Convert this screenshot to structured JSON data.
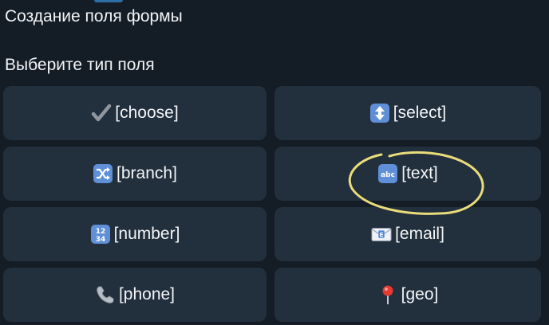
{
  "header": {
    "title": "Создание поля формы",
    "prompt": "Выберите тип поля"
  },
  "buttons": [
    {
      "label": "[choose]",
      "icon": "check-mark-icon"
    },
    {
      "label": "[select]",
      "icon": "up-down-arrow-icon"
    },
    {
      "label": "[branch]",
      "icon": "shuffle-icon"
    },
    {
      "label": "[text]",
      "icon": "abc-input-icon"
    },
    {
      "label": "[number]",
      "icon": "numbers-1234-icon"
    },
    {
      "label": "[email]",
      "icon": "envelope-icon"
    },
    {
      "label": "[phone]",
      "icon": "telephone-receiver-icon"
    },
    {
      "label": "[geo]",
      "icon": "round-pushpin-icon"
    }
  ],
  "colors": {
    "background": "#141c26",
    "button": "#222f3d",
    "annotation": "#e9dc7a"
  }
}
